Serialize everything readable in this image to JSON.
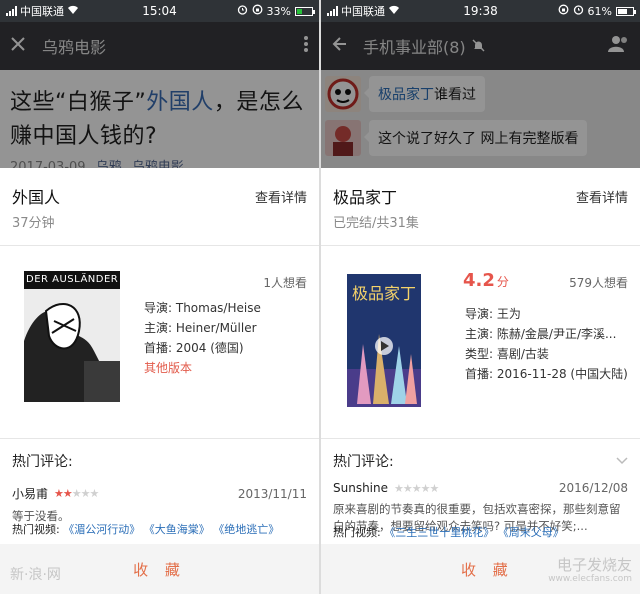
{
  "left": {
    "status": {
      "carrier": "中国联通",
      "time": "15:04",
      "battery": "33%",
      "battery_level": 0.33
    },
    "navbar": {
      "title": "乌鸦电影"
    },
    "article": {
      "title_part1": "这些“白猴子”",
      "title_highlight": "外国人",
      "title_part2": "，是怎么赚中国人钱的?",
      "date": "2017-03-09",
      "source1": "乌鸦",
      "source2": "乌鸦电影"
    },
    "card": {
      "name": "外国人",
      "sub": "37分钟",
      "detail_link": "查看详情",
      "want": "1人想看",
      "poster_text": "DER AUSLÄNDER",
      "director": "导演: Thomas/Heise",
      "cast": "主演: Heiner/Müller",
      "premiere": "首播: 2004 (德国)",
      "other_versions": "其他版本",
      "hot_reviews_label": "热门评论:",
      "review": {
        "user": "小易甫",
        "stars": 2,
        "date": "2013/11/11",
        "text": "等于没看。"
      },
      "hot_videos_label": "热门视频:",
      "videos": [
        "《湄公河行动》",
        "《大鱼海棠》",
        "《绝地逃亡》"
      ],
      "collect": "收 藏"
    },
    "watermark": "新·浪·网"
  },
  "right": {
    "status": {
      "carrier": "中国联通",
      "time": "19:38",
      "battery": "61%",
      "battery_level": 0.61
    },
    "navbar": {
      "title": "手机事业部(8)"
    },
    "chat": [
      {
        "mention": "极品家丁",
        "text": "谁看过"
      },
      {
        "mention": "",
        "text": "这个说了好久了 网上有完整版看"
      }
    ],
    "card": {
      "name": "极品家丁",
      "sub": "已完结/共31集",
      "detail_link": "查看详情",
      "score": "4.2",
      "score_unit": "分",
      "want": "579人想看",
      "poster_text": "极品家丁",
      "director": "导演: 王为",
      "cast": "主演: 陈赫/金晨/尹正/李溪...",
      "genre": "类型: 喜剧/古装",
      "premiere": "首播: 2016-11-28 (中国大陆)",
      "hot_reviews_label": "热门评论:",
      "review": {
        "user": "Sunshine",
        "stars": 0,
        "date": "2016/12/08",
        "text": "原来喜剧的节奏真的很重要，包括欢喜密探，那些刻意留白的节奏，想要留给观众去笑吗? 可是并不好笑;..."
      },
      "hot_videos_label": "热门视频:",
      "videos": [
        "《三生三世十里桃花》",
        "《周末父母》"
      ],
      "collect": "收 藏"
    },
    "watermark": "电子发烧友",
    "watermark_url": "www.elecfans.com"
  },
  "colors": {
    "accent_red": "#e6554b",
    "link_blue": "#2c6fb8",
    "collect_orange": "#e36f49",
    "navbar": "#393a3f"
  }
}
